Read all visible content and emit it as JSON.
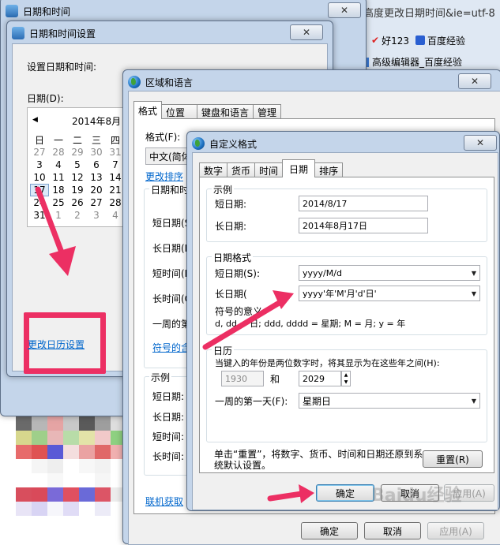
{
  "browser": {
    "tab_title": "高度更改日期时间&ie=utf-8",
    "bookmarks": [
      "好123",
      "百度经验"
    ],
    "second_tab": "高级编辑器_百度经验"
  },
  "datetime_window": {
    "title": "日期和时间",
    "close": "✕",
    "settings_dialog": {
      "title": "日期和时间设置",
      "close": "✕",
      "set_label": "设置日期和时间:",
      "date_label": "日期(D):",
      "month_label": "2014年8月",
      "weekdays": [
        "日",
        "一",
        "二",
        "三",
        "四"
      ],
      "weeks": [
        [
          "27",
          "28",
          "29",
          "30",
          "31"
        ],
        [
          "3",
          "4",
          "5",
          "6",
          "7"
        ],
        [
          "10",
          "11",
          "12",
          "13",
          "14"
        ],
        [
          "17",
          "18",
          "19",
          "20",
          "21"
        ],
        [
          "24",
          "25",
          "26",
          "27",
          "28"
        ],
        [
          "31",
          "1",
          "2",
          "3",
          "4"
        ]
      ],
      "change_calendar_link": "更改日历设置"
    }
  },
  "region_dialog": {
    "title": "区域和语言",
    "close": "✕",
    "tabs": [
      "格式",
      "位置",
      "键盘和语言",
      "管理"
    ],
    "format_label": "格式(F):",
    "format_value": "中文(简体",
    "sort_link": "更改排序",
    "datetime_group": "日期和时",
    "rows": [
      "短日期(S",
      "长日期(L",
      "短时间(H",
      "长时间(O",
      "一周的第"
    ],
    "symbol_link": "符号的含",
    "example_group": "示例",
    "example_rows": [
      "短日期:",
      "长日期:",
      "短时间:",
      "长时间:"
    ],
    "online_link": "联机获取",
    "ok": "确定",
    "cancel": "取消",
    "apply": "应用(A)"
  },
  "custom_dialog": {
    "title": "自定义格式",
    "close": "✕",
    "tabs": [
      "数字",
      "货币",
      "时间",
      "日期",
      "排序"
    ],
    "example_group": "示例",
    "short_date_label": "短日期:",
    "short_date_value": "2014/8/17",
    "long_date_label": "长日期:",
    "long_date_value": "2014年8月17日",
    "format_group": "日期格式",
    "short_format_label": "短日期(S):",
    "short_format_value": "yyyy/M/d",
    "long_format_label": "长日期(",
    "long_format_value": "yyyy'年'M'月'd'日'",
    "symbol_meaning": "符号的意义:",
    "symbol_legend": "d, dd = 日;  ddd, dddd = 星期;  M = 月;  y = 年",
    "calendar_group": "日历",
    "two_digit_text": "当键入的年份是两位数字时，将其显示为在这些年之间(H):",
    "year_from": "1930",
    "year_and": "和",
    "year_to": "2029",
    "first_day_label": "一周的第一天(F):",
    "first_day_value": "星期日",
    "reset_note_1": "单击“重置”，将数字、货币、时间和日期还原到系",
    "reset_note_2": "统默认设置。",
    "reset_button": "重置(R)",
    "ok": "确定",
    "cancel": "取消",
    "apply": "应用(A)"
  },
  "watermark": "Baidu经验",
  "colors": {
    "annotation": "#ec2f63",
    "title_glass": "#c4d5ea",
    "link": "#0066cc"
  }
}
